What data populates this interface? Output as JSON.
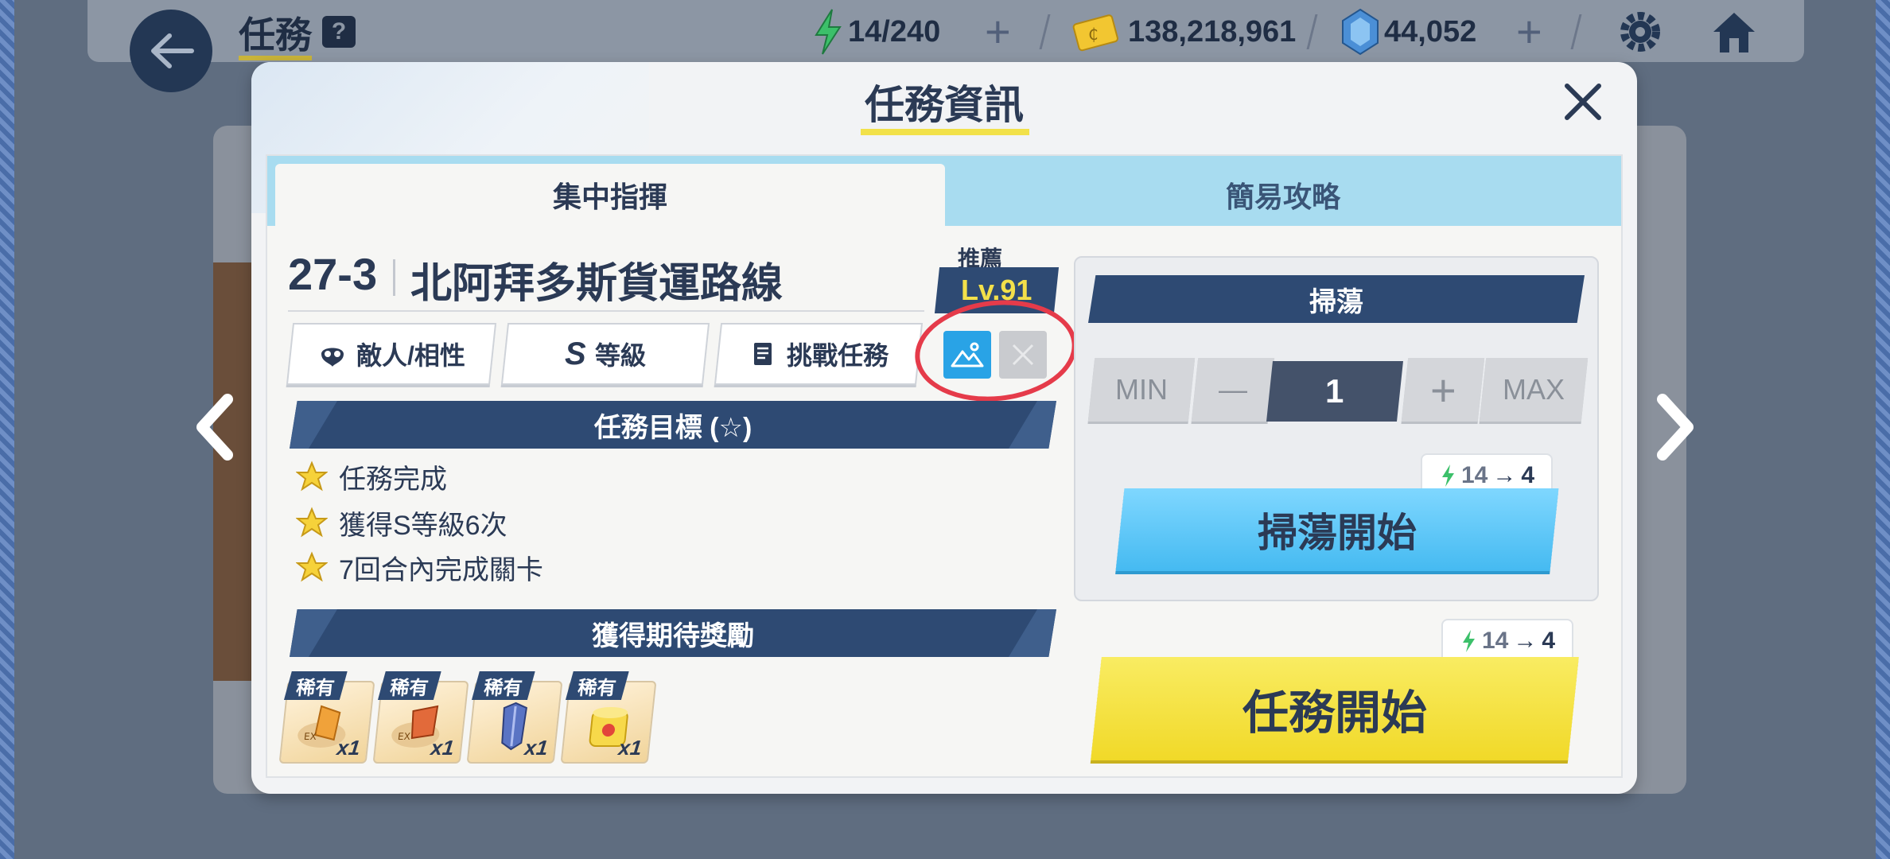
{
  "topbar": {
    "title": "任務",
    "help": "?",
    "ap": "14/240",
    "credits": "138,218,961",
    "gems": "44,052",
    "plus": "+"
  },
  "dialog": {
    "title": "任務資訊",
    "tabs": [
      {
        "label": "集中指揮",
        "active": true
      },
      {
        "label": "簡易攻略",
        "active": false
      }
    ],
    "stage": {
      "number": "27-3",
      "name": "北阿拜多斯貨運路線"
    },
    "recommend": {
      "label": "推薦",
      "level": "Lv.91"
    },
    "buttons": {
      "enemy": "敵人/相性",
      "rank_letter": "S",
      "rank": "等級",
      "challenge": "挑戰任務"
    },
    "objectives": {
      "header": "任務目標 (☆)",
      "items": [
        "任務完成",
        "獲得S等級6次",
        "7回合內完成關卡"
      ]
    },
    "rewards": {
      "header": "獲得期待獎勵",
      "items": [
        {
          "tag": "稀有",
          "qty": "x1",
          "icon": "ex-report-orange"
        },
        {
          "tag": "稀有",
          "qty": "x1",
          "icon": "ex-report-red"
        },
        {
          "tag": "稀有",
          "qty": "x1",
          "icon": "blue-gear"
        },
        {
          "tag": "稀有",
          "qty": "x1",
          "icon": "canned-item"
        }
      ]
    },
    "sweep": {
      "header": "掃蕩",
      "min": "MIN",
      "minus": "—",
      "count": "1",
      "plus": "+",
      "max": "MAX",
      "cost_from": "14",
      "cost_arrow": "→",
      "cost_to": "4",
      "start": "掃蕩開始"
    },
    "mission": {
      "cost_from": "14",
      "cost_arrow": "→",
      "cost_to": "4",
      "start": "任務開始"
    }
  },
  "colors": {
    "navy": "#2e4a73",
    "accent_yellow": "#f1d928",
    "accent_blue": "#45baf1",
    "highlight_red": "#e53b4a"
  }
}
